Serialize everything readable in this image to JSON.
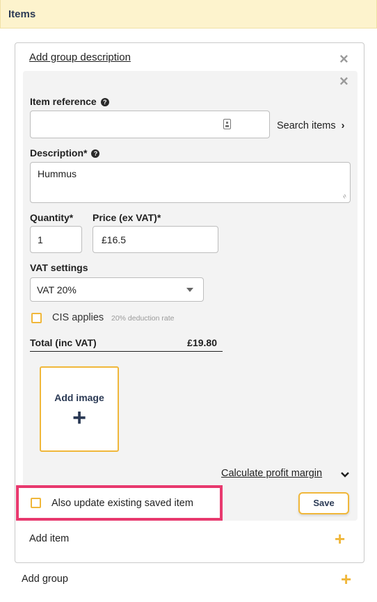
{
  "section": {
    "title": "Items"
  },
  "group": {
    "description_link": "Add group description"
  },
  "item": {
    "reference": {
      "label": "Item reference",
      "value": "",
      "search_label": "Search items"
    },
    "description": {
      "label": "Description*",
      "value": "Hummus"
    },
    "quantity": {
      "label": "Quantity*",
      "value": "1"
    },
    "price": {
      "label": "Price (ex VAT)*",
      "value": "£16.5"
    },
    "vat": {
      "label": "VAT settings",
      "selected": "VAT 20%"
    },
    "cis": {
      "label": "CIS applies",
      "note": "20% deduction rate"
    },
    "total": {
      "label": "Total (inc VAT)",
      "value": "£19.80"
    },
    "add_image": {
      "label": "Add image"
    },
    "profit_link": "Calculate profit margin",
    "update_saved": {
      "label": "Also update existing saved item"
    },
    "save_label": "Save"
  },
  "add_item_label": "Add item",
  "add_group_label": "Add group",
  "icons": {
    "close": "close-icon",
    "help": "help-icon",
    "barcode": "barcode-icon",
    "chevron_right": "chevron-right-icon",
    "caret_down": "caret-down-icon",
    "chevron_down": "chevron-down-icon",
    "plus": "plus-icon"
  },
  "colors": {
    "accent": "#f0b73a",
    "highlight": "#e8396e",
    "header_bg": "#fdf3cd",
    "navy": "#2b3a55"
  }
}
